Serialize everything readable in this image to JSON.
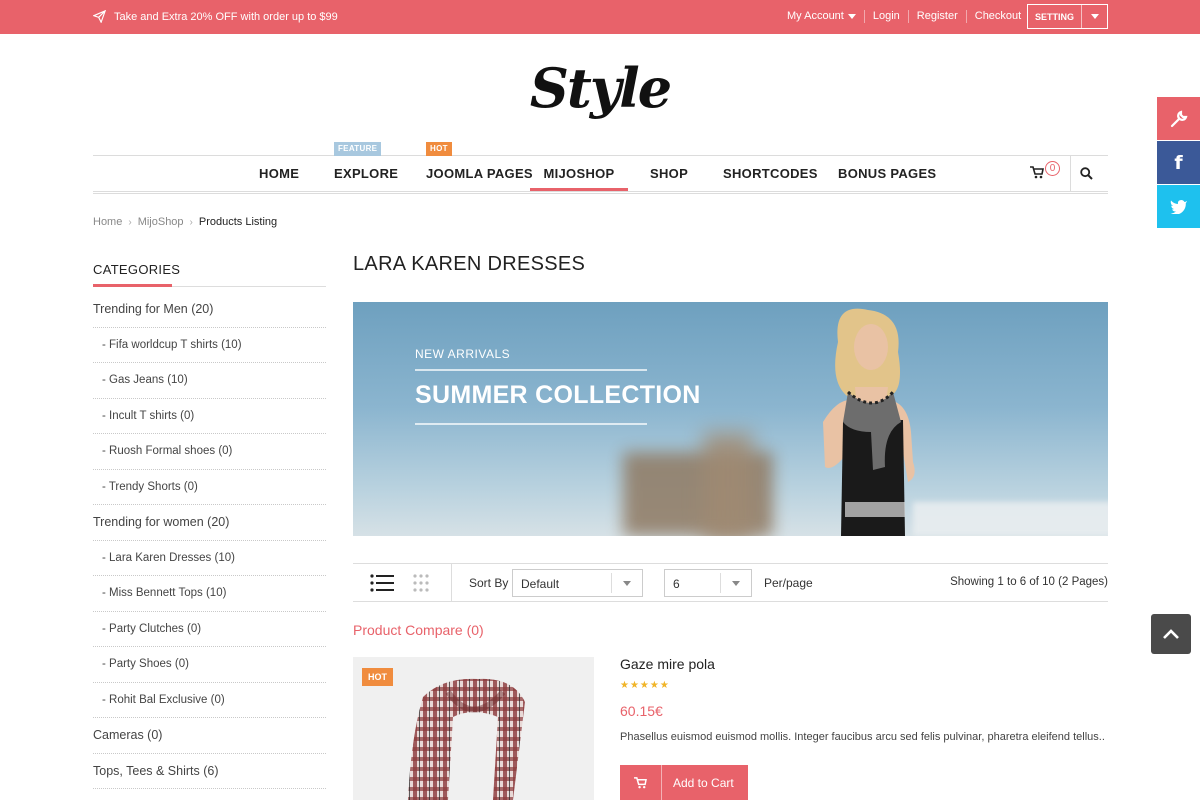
{
  "topbar": {
    "promo": "Take and Extra 20% OFF with order up to $99",
    "my_account": "My Account",
    "login": "Login",
    "register": "Register",
    "checkout": "Checkout",
    "setting": "SETTING"
  },
  "logo": "Style",
  "nav": {
    "items": [
      {
        "label": "HOME"
      },
      {
        "label": "EXPLORE",
        "tag": "FEATURE"
      },
      {
        "label": "JOOMLA PAGES",
        "tag": "HOT"
      },
      {
        "label": "MIJOSHOP"
      },
      {
        "label": "SHOP"
      },
      {
        "label": "SHORTCODES"
      },
      {
        "label": "BONUS PAGES"
      }
    ],
    "active": "MIJOSHOP",
    "cart_count": "0"
  },
  "breadcrumb": [
    "Home",
    "MijoShop",
    "Products Listing"
  ],
  "sidebar": {
    "title": "CATEGORIES",
    "items": [
      {
        "label": "Trending for Men (20)",
        "sub": false
      },
      {
        "label": "- Fifa worldcup T shirts (10)",
        "sub": true
      },
      {
        "label": "- Gas Jeans (10)",
        "sub": true
      },
      {
        "label": "- Incult T shirts (0)",
        "sub": true
      },
      {
        "label": "- Ruosh Formal shoes (0)",
        "sub": true
      },
      {
        "label": "- Trendy Shorts (0)",
        "sub": true
      },
      {
        "label": "Trending for women (20)",
        "sub": false
      },
      {
        "label": "- Lara Karen Dresses (10)",
        "sub": true
      },
      {
        "label": "- Miss Bennett Tops (10)",
        "sub": true
      },
      {
        "label": "- Party Clutches (0)",
        "sub": true
      },
      {
        "label": "- Party Shoes (0)",
        "sub": true
      },
      {
        "label": "- Rohit Bal Exclusive (0)",
        "sub": true
      },
      {
        "label": "Cameras (0)",
        "sub": false
      },
      {
        "label": "Tops, Tees & Shirts (6)",
        "sub": false
      }
    ]
  },
  "main": {
    "title": "LARA KAREN DRESSES",
    "banner": {
      "subtitle": "NEW ARRIVALS",
      "title": "SUMMER COLLECTION"
    },
    "toolbar": {
      "sort_label": "Sort By",
      "sort_value": "Default",
      "per_page_value": "6",
      "per_page_label": "Per/page",
      "showing": "Showing 1 to 6 of 10 (2 Pages)"
    },
    "compare": "Product Compare (0)",
    "product": {
      "badge": "HOT",
      "name": "Gaze mire pola",
      "rating": 5,
      "stars": "★★★★★",
      "price": "60.15€",
      "description": "Phasellus euismod euismod mollis. Integer faucibus arcu sed felis pulvinar, pharetra eleifend tellus..",
      "add_to_cart": "Add to Cart"
    }
  },
  "colors": {
    "accent": "#e8626a",
    "facebook": "#3b5998",
    "twitter": "#1ec1ee",
    "hot_tag": "#f08c3e",
    "feature_tag": "#a8c8df"
  }
}
